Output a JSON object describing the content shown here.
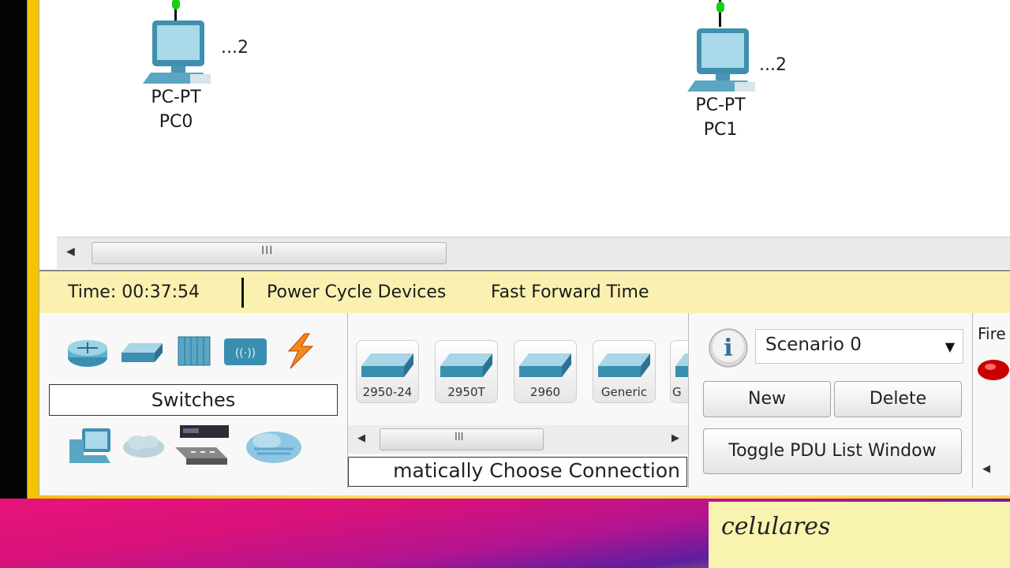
{
  "workspace": {
    "pc0": {
      "model": "PC-PT",
      "name": "PC0",
      "ip": "...2"
    },
    "pc1": {
      "model": "PC-PT",
      "name": "PC1",
      "ip": "...2"
    }
  },
  "timebar": {
    "time": "Time: 00:37:54",
    "power_cycle": "Power Cycle Devices",
    "fast_forward": "Fast Forward Time"
  },
  "categories": {
    "selected_label": "Switches",
    "icons": [
      "router-icon",
      "switch-icon",
      "hub-icon",
      "wireless-icon",
      "connection-icon",
      "end-device-icon",
      "wan-cloud-icon",
      "custom-device-icon",
      "multiuser-icon"
    ]
  },
  "devices": {
    "items": [
      {
        "name": "2950-24"
      },
      {
        "name": "2950T"
      },
      {
        "name": "2960"
      },
      {
        "name": "Generic"
      },
      {
        "name": "G"
      }
    ],
    "connection_label": "matically Choose Connection"
  },
  "scenario": {
    "selected": "Scenario 0",
    "new_label": "New",
    "delete_label": "Delete",
    "toggle_label": "Toggle PDU List Window"
  },
  "fire": {
    "label": "Fire"
  },
  "desktop": {
    "sticky_note": "celulares"
  },
  "colors": {
    "timebar_bg": "#faf1b0",
    "link_up": "#15d015",
    "accent_teal": "#3a9ec0"
  }
}
